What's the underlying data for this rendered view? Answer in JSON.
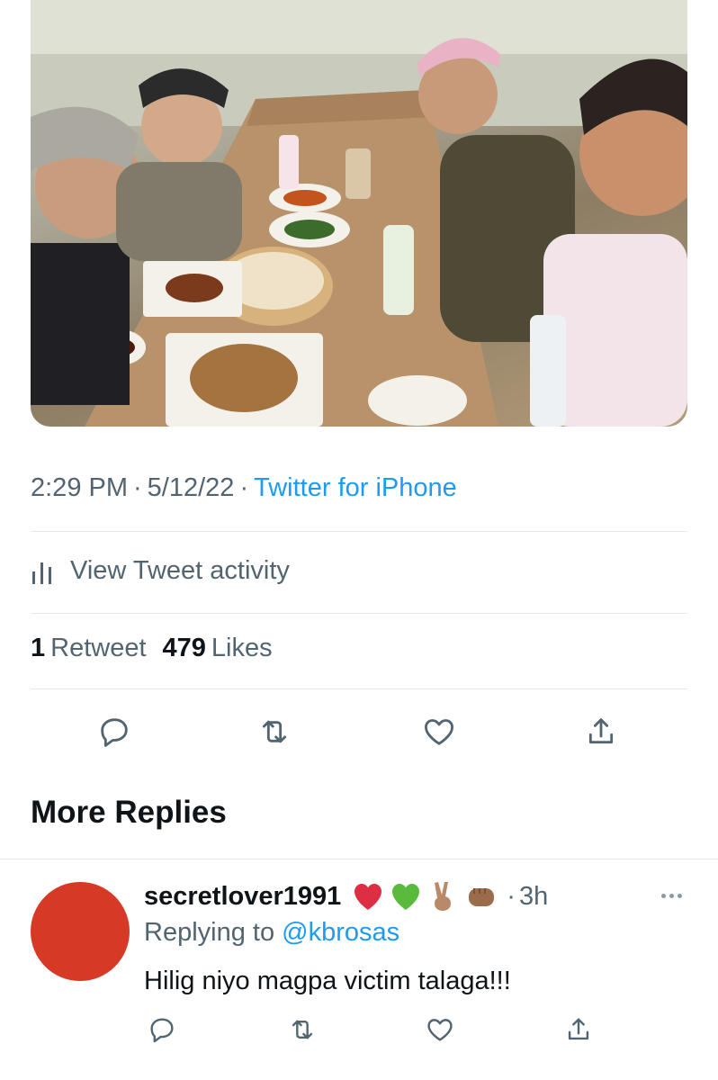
{
  "tweet": {
    "time": "2:29 PM",
    "date": "5/12/22",
    "source": "Twitter for iPhone",
    "activity_label": "View Tweet activity",
    "retweet_count": "1",
    "retweet_label": "Retweet",
    "like_count": "479",
    "like_label": "Likes",
    "photo_icon": "restaurant-group-photo"
  },
  "actions": {
    "reply_icon": "reply-icon",
    "retweet_icon": "retweet-icon",
    "like_icon": "heart-icon",
    "share_icon": "share-icon"
  },
  "more_replies": {
    "title": "More Replies"
  },
  "reply": {
    "username": "secretlover1991",
    "emojis": [
      "red-heart",
      "green-heart",
      "victory-hand",
      "oncoming-fist"
    ],
    "separator": "·",
    "time": "3h",
    "replying_prefix": "Replying to",
    "replying_handle": "@kbrosas",
    "text": "Hilig niyo magpa victim talaga!!!",
    "avatar_color": "#d63a26"
  },
  "colors": {
    "link": "#1d9bf0",
    "secondary_text": "#536471",
    "primary_text": "#0f1419",
    "divider": "#e6e9eb"
  }
}
